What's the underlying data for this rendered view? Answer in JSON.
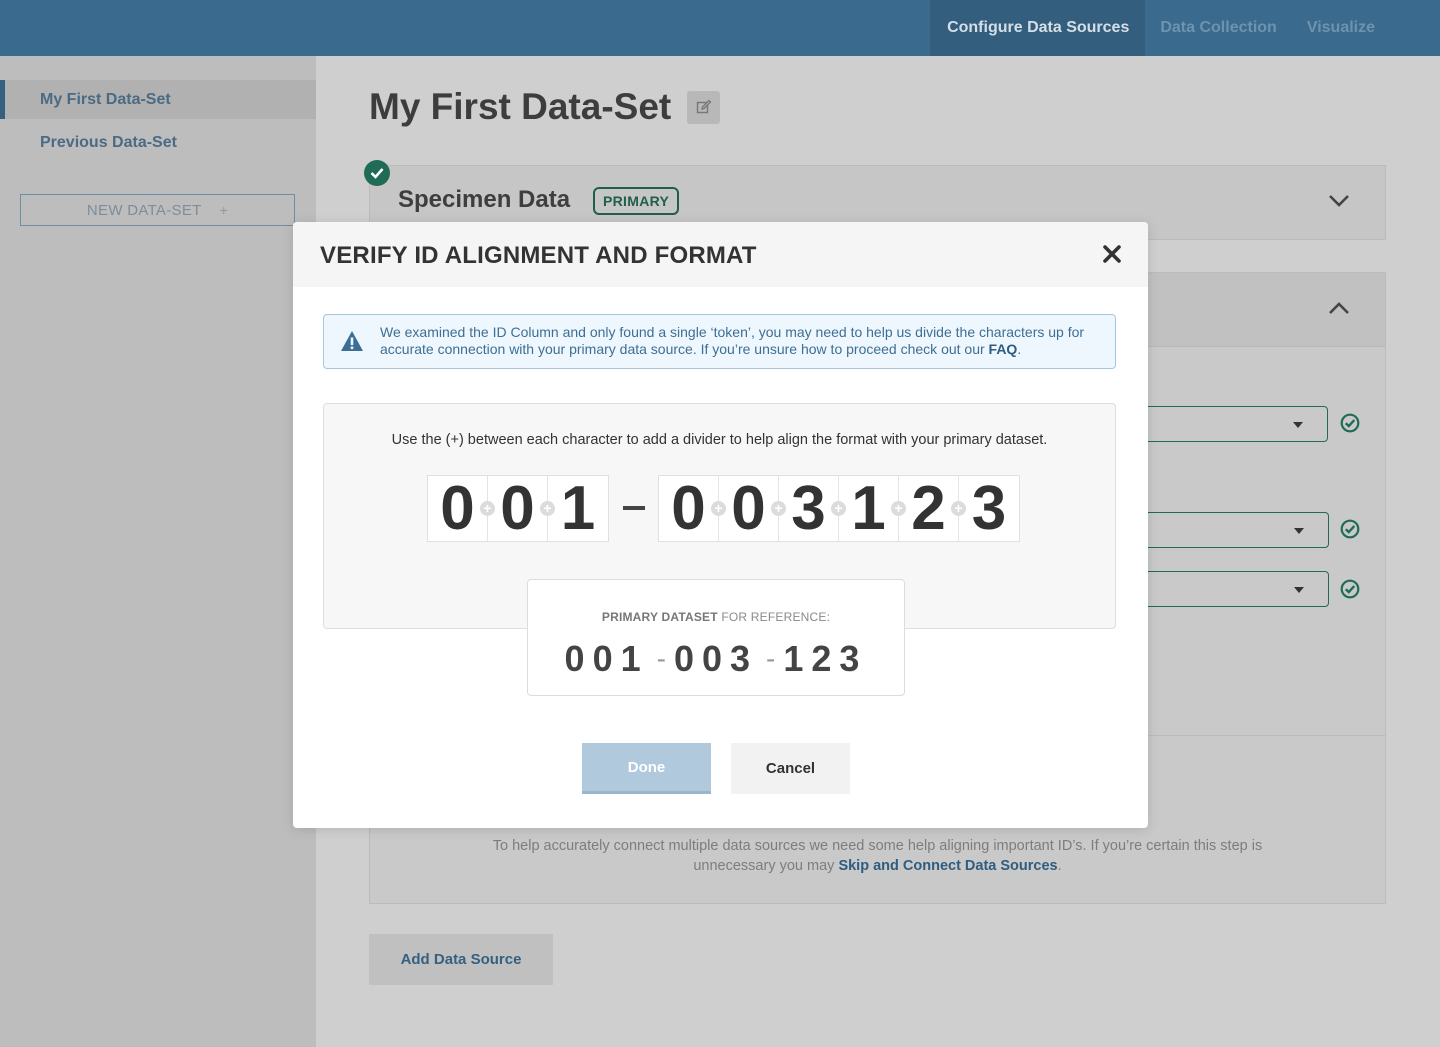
{
  "topnav": {
    "items": [
      {
        "label": "Configure Data Sources",
        "active": true
      },
      {
        "label": "Data Collection",
        "active": false
      },
      {
        "label": "Visualize",
        "active": false
      }
    ]
  },
  "sidebar": {
    "items": [
      {
        "label": "My First Data-Set",
        "active": true
      },
      {
        "label": "Previous Data-Set",
        "active": false
      }
    ],
    "new_label": "NEW DATA-SET",
    "new_icon": "+"
  },
  "main": {
    "title": "My First Data-Set",
    "card1": {
      "title": "Specimen Data",
      "badge": "PRIMARY"
    },
    "help_text": "To help accurately connect multiple data sources we need some help aligning important ID’s. If you’re certain this step is unnecessary you may ",
    "help_link": "Skip and Connect Data Sources",
    "help_end": ".",
    "add_source_label": "Add Data Source"
  },
  "modal": {
    "title": "VERIFY ID ALIGNMENT AND FORMAT",
    "alert_text": "We examined the ID Column and only found a single ‘token’, you may need to help us divide the characters up for accurate connection with your primary data source. If you’re unsure how to proceed check out our ",
    "alert_link": "FAQ",
    "alert_end": ".",
    "instructions": "Use the (+) between each character to add a divider to help align the format with your primary dataset.",
    "group1": [
      "0",
      "0",
      "1"
    ],
    "separator": "-",
    "group2": [
      "0",
      "0",
      "3",
      "1",
      "2",
      "3"
    ],
    "reference": {
      "label_bold": "PRIMARY DATASET",
      "label_rest": " FOR REFERENCE:",
      "segments": [
        "001",
        "003",
        "123"
      ],
      "dash": "-"
    },
    "done_label": "Done",
    "cancel_label": "Cancel"
  },
  "colors": {
    "accent": "#3a6a8e",
    "success": "#1f6b55",
    "done_disabled": "#b0c9dd"
  }
}
